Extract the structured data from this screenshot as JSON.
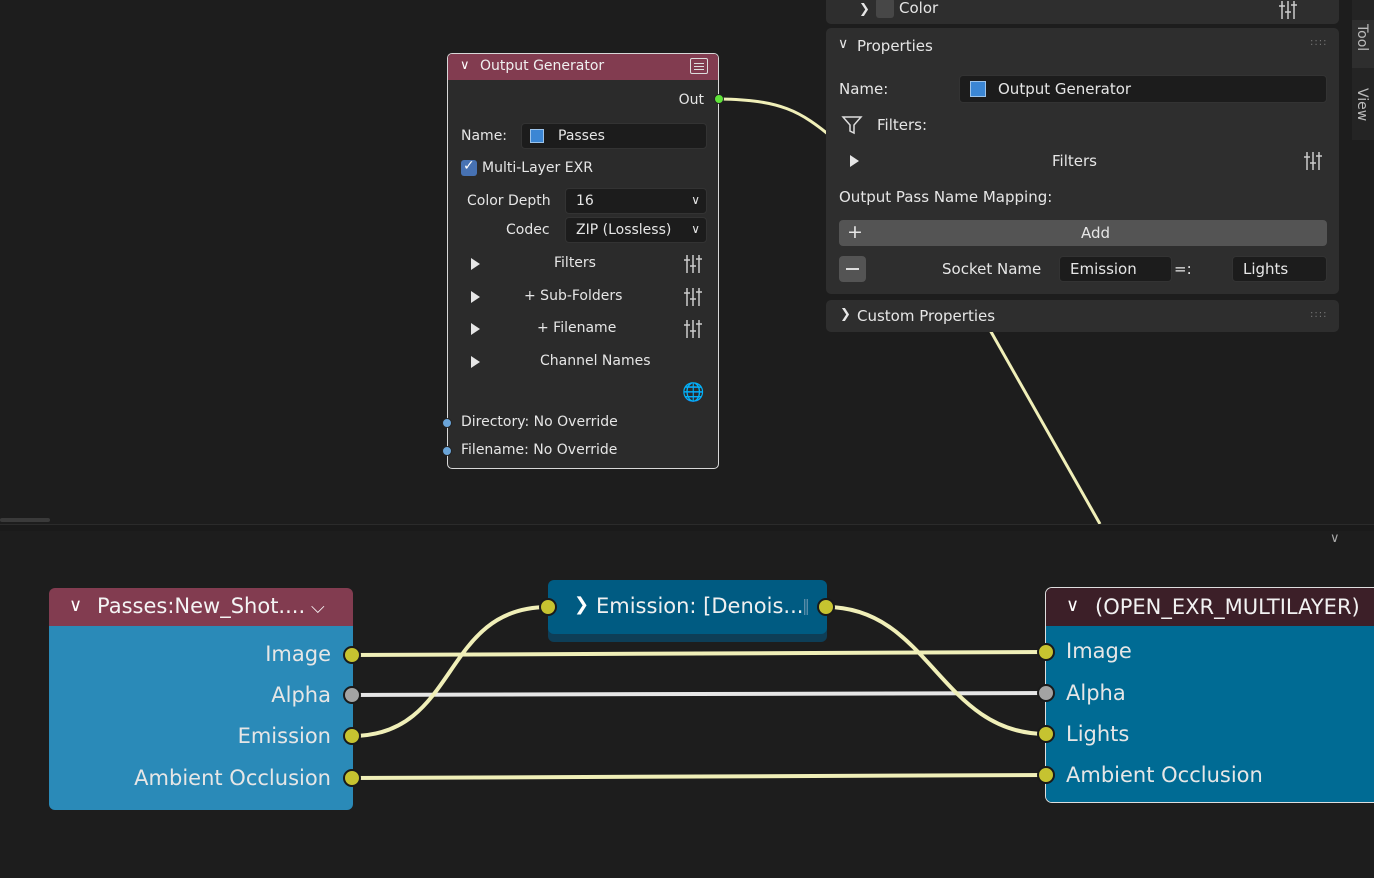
{
  "og_node": {
    "title": "Output Generator",
    "out_label": "Out",
    "name_label": "Name:",
    "name_value": "Passes",
    "multilayer_label": "Multi-Layer EXR",
    "multilayer_checked": true,
    "color_depth_label": "Color Depth",
    "color_depth_value": "16",
    "codec_label": "Codec",
    "codec_value": "ZIP (Lossless)",
    "rows": [
      {
        "label": "Filters"
      },
      {
        "label": "+ Sub-Folders"
      },
      {
        "label": "+ Filename"
      },
      {
        "label": "Channel Names"
      }
    ],
    "directory_label": "Directory: No Override",
    "filename_label": "Filename: No Override"
  },
  "panel": {
    "color_label": "Color",
    "properties_title": "Properties",
    "name_label": "Name:",
    "name_value": "Output Generator",
    "filters_label": "Filters:",
    "filters_row": "Filters",
    "mapping_label": "Output Pass Name Mapping:",
    "add_label": "Add",
    "socket_name_label": "Socket Name",
    "socket_from": "Emission",
    "equals": "=:",
    "socket_to": "Lights",
    "custom_props": "Custom Properties",
    "side_tabs": [
      "Tool",
      "View"
    ]
  },
  "passes_node": {
    "title": "Passes:New_Shot....",
    "outputs": [
      "Image",
      "Alpha",
      "Emission",
      "Ambient Occlusion"
    ]
  },
  "reroute_node": {
    "title": "Emission: [Denois..."
  },
  "exr_node": {
    "title": "(OPEN_EXR_MULTILAYER)",
    "inputs": [
      "Image",
      "Alpha",
      "Lights",
      "Ambient Occlusion"
    ]
  },
  "colors": {
    "wire_yellow": "#f0efb8",
    "socket_yellow": "#c6c330",
    "socket_gray": "#a3a3a3",
    "node_header_red": "#823c50",
    "node_body_blue": "#2a8ab8",
    "exr_body_blue": "#006b94",
    "accent_green": "#5fe33a"
  }
}
